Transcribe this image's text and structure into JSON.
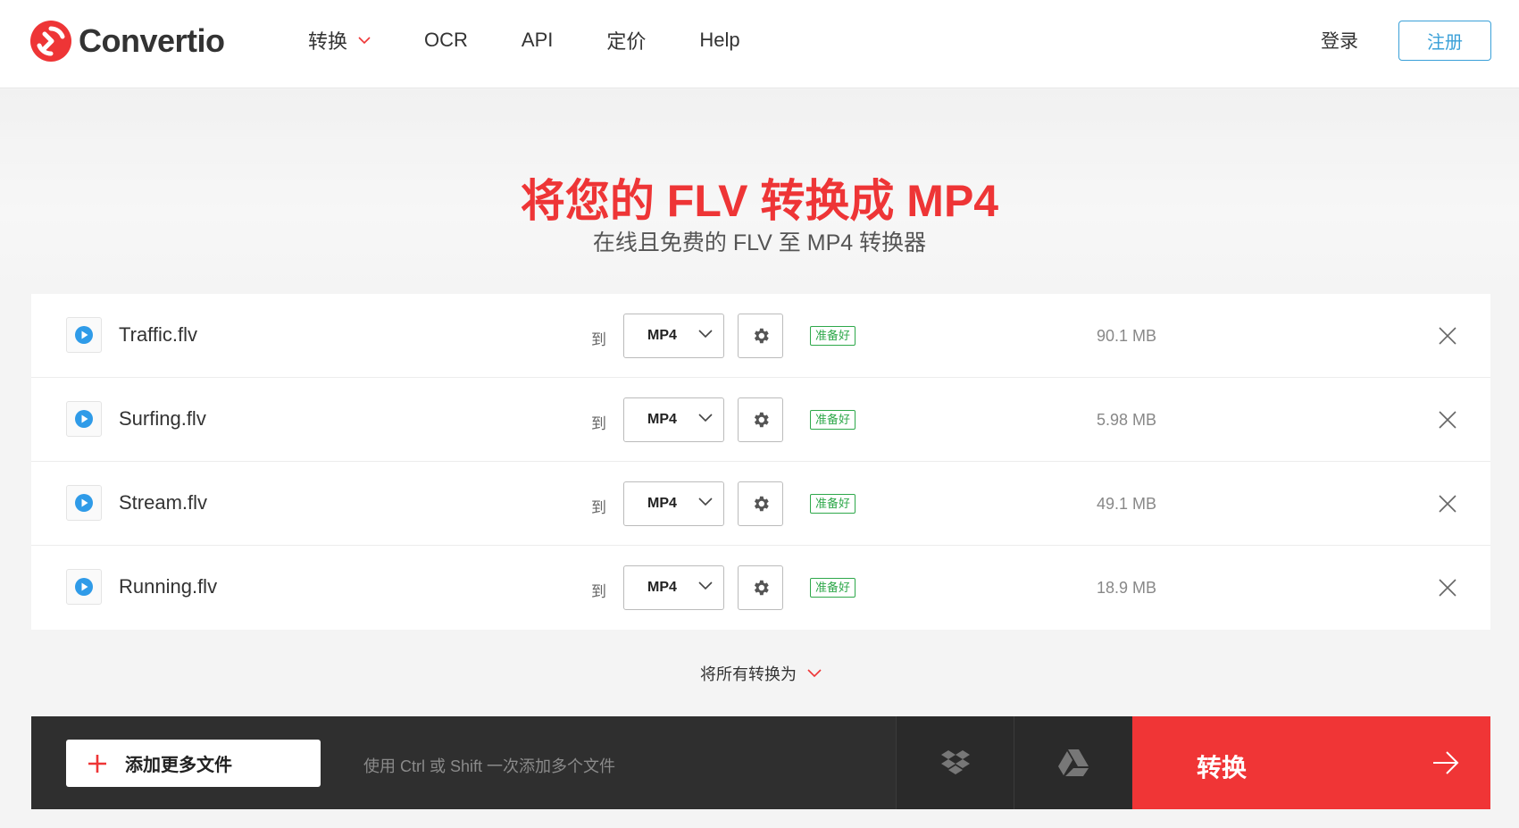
{
  "header": {
    "logo_text": "Convertio",
    "nav": [
      {
        "label": "转换",
        "has_dropdown": true
      },
      {
        "label": "OCR"
      },
      {
        "label": "API"
      },
      {
        "label": "定价"
      },
      {
        "label": "Help"
      }
    ],
    "login_label": "登录",
    "register_label": "注册"
  },
  "hero": {
    "title": "将您的 FLV 转换成 MP4",
    "subtitle": "在线且免费的 FLV 至 MP4 转换器"
  },
  "files": [
    {
      "name": "Traffic.flv",
      "to_label": "到",
      "format": "MP4",
      "status": "准备好",
      "size": "90.1 MB"
    },
    {
      "name": "Surfing.flv",
      "to_label": "到",
      "format": "MP4",
      "status": "准备好",
      "size": "5.98 MB"
    },
    {
      "name": "Stream.flv",
      "to_label": "到",
      "format": "MP4",
      "status": "准备好",
      "size": "49.1 MB"
    },
    {
      "name": "Running.flv",
      "to_label": "到",
      "format": "MP4",
      "status": "准备好",
      "size": "18.9 MB"
    }
  ],
  "convert_all_label": "将所有转换为",
  "bottom": {
    "add_files_label": "添加更多文件",
    "hint": "使用 Ctrl 或 Shift 一次添加多个文件",
    "convert_label": "转换"
  },
  "colors": {
    "brand_red": "#ee3536",
    "link_blue": "#3aa0d8",
    "ready_green": "#2ea84a",
    "play_blue": "#2f9be8"
  },
  "icons": {
    "logo": "convertio-logo-icon",
    "play": "play-icon",
    "gear": "gear-icon",
    "close": "close-icon",
    "chevron": "chevron-down-icon",
    "plus": "plus-icon",
    "dropbox": "dropbox-icon",
    "gdrive": "google-drive-icon",
    "arrow": "arrow-right-icon"
  }
}
